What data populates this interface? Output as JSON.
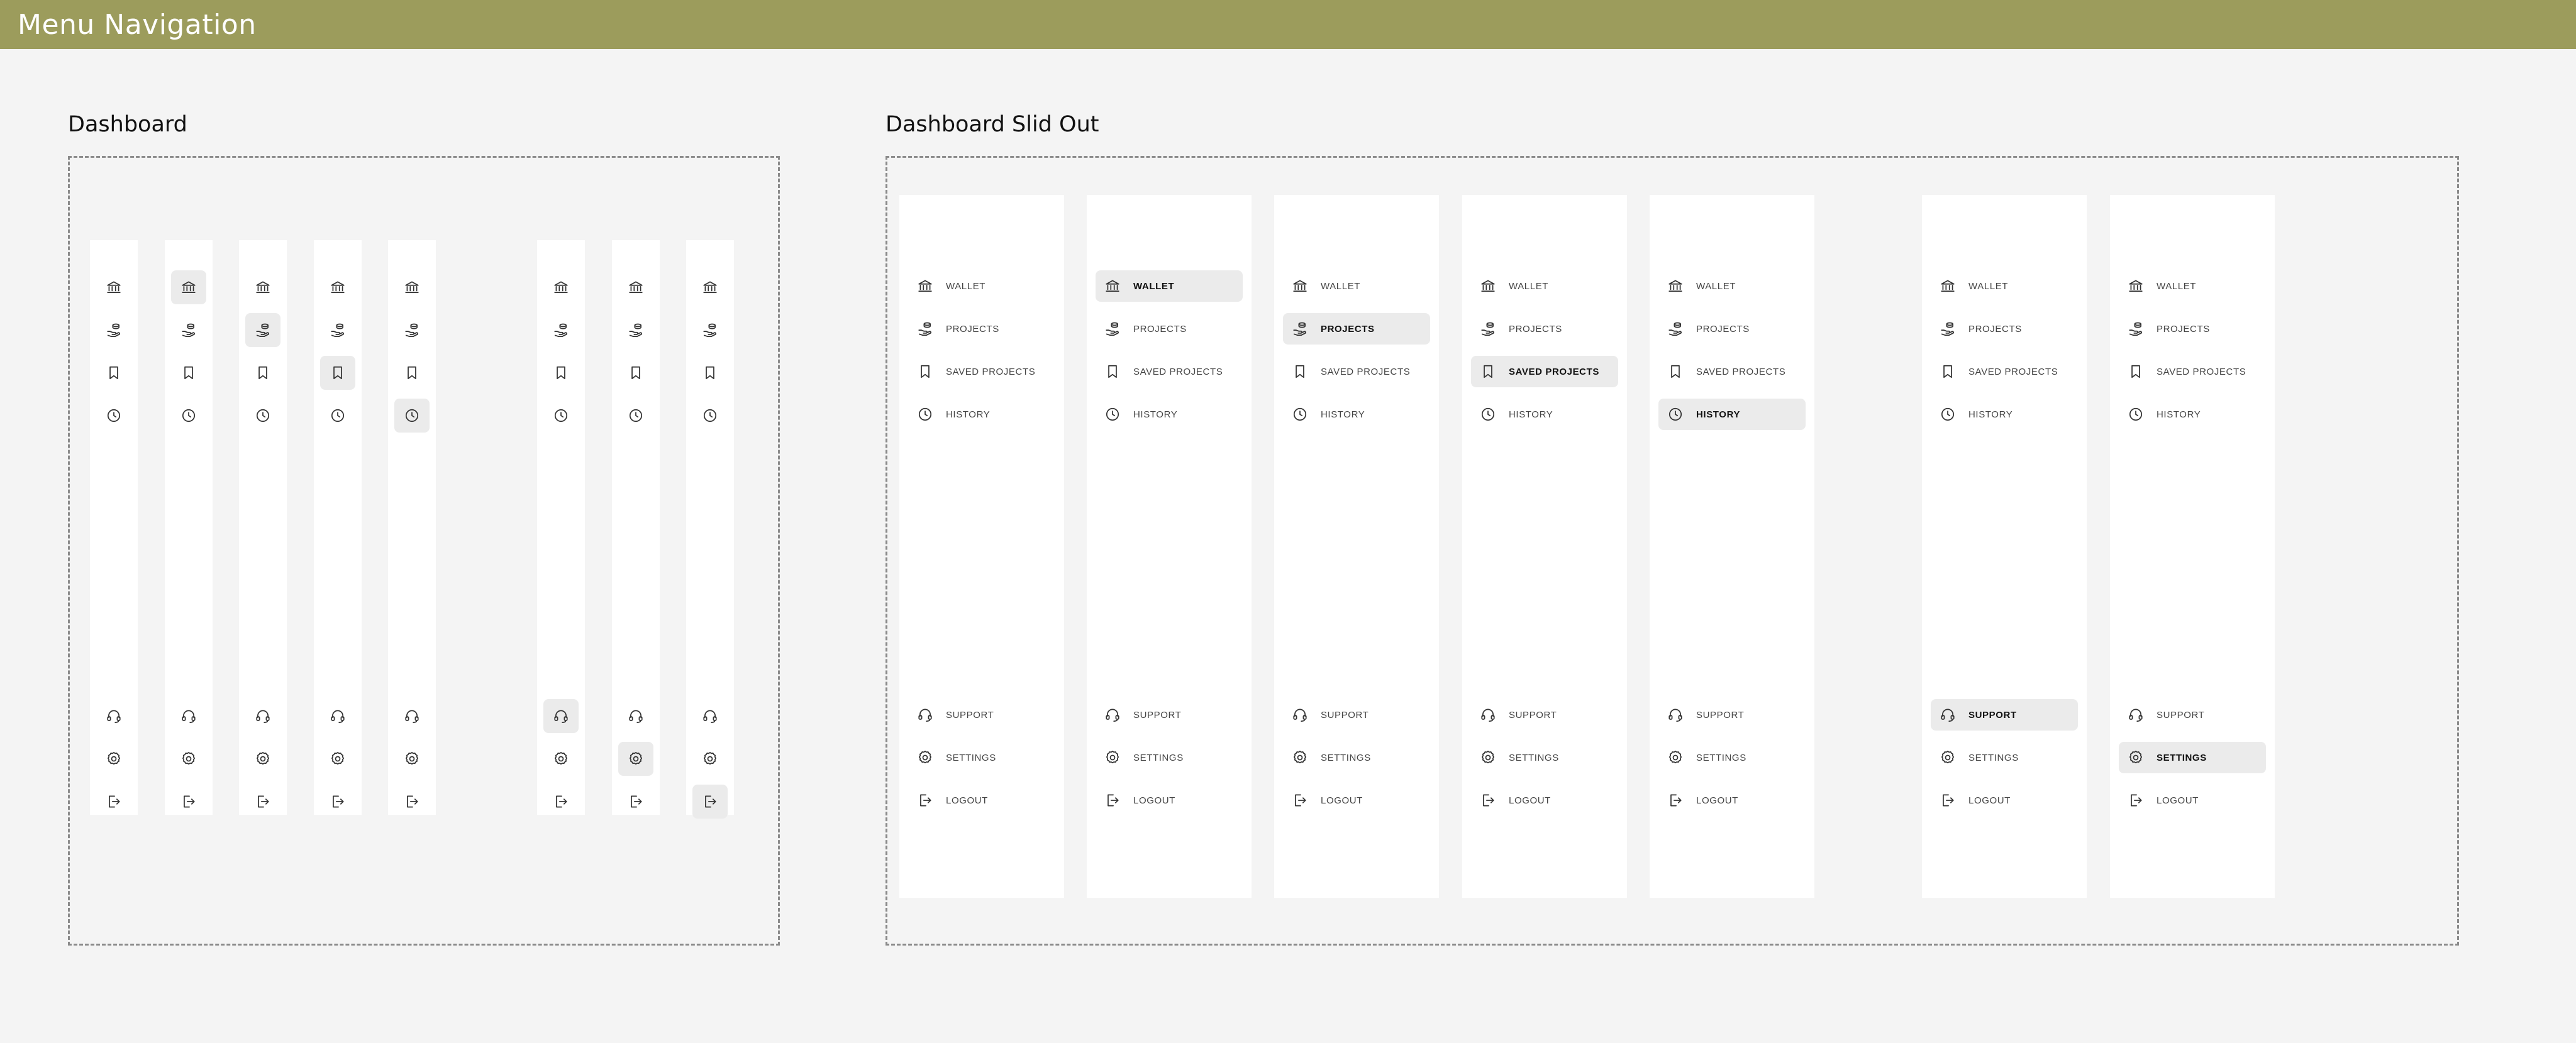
{
  "app": {
    "title": "Menu Navigation",
    "accent_color": "#9c9c5c"
  },
  "sections": {
    "dashboard": {
      "title": "Dashboard"
    },
    "slid_out": {
      "title": "Dashboard Slid Out"
    }
  },
  "menu": {
    "top_items": [
      {
        "id": "wallet",
        "label": "WALLET",
        "icon": "bank-icon"
      },
      {
        "id": "projects",
        "label": "PROJECTS",
        "icon": "coin-hand-icon"
      },
      {
        "id": "saved-projects",
        "label": "SAVED PROJECTS",
        "icon": "bookmark-icon"
      },
      {
        "id": "history",
        "label": "HISTORY",
        "icon": "clock-icon"
      }
    ],
    "bottom_items": [
      {
        "id": "support",
        "label": "SUPPORT",
        "icon": "headset-icon"
      },
      {
        "id": "settings",
        "label": "SETTINGS",
        "icon": "gear-icon"
      },
      {
        "id": "logout",
        "label": "LOGOUT",
        "icon": "logout-icon"
      }
    ]
  },
  "collapsed_variants": [
    {
      "active": "none"
    },
    {
      "active": "wallet"
    },
    {
      "active": "projects"
    },
    {
      "active": "saved-projects"
    },
    {
      "active": "history"
    },
    {
      "active": "support"
    },
    {
      "active": "settings"
    },
    {
      "active": "logout"
    }
  ],
  "expanded_variants": [
    {
      "active": "none"
    },
    {
      "active": "wallet"
    },
    {
      "active": "projects"
    },
    {
      "active": "saved-projects"
    },
    {
      "active": "history"
    },
    {
      "active": "support"
    },
    {
      "active": "settings"
    }
  ]
}
